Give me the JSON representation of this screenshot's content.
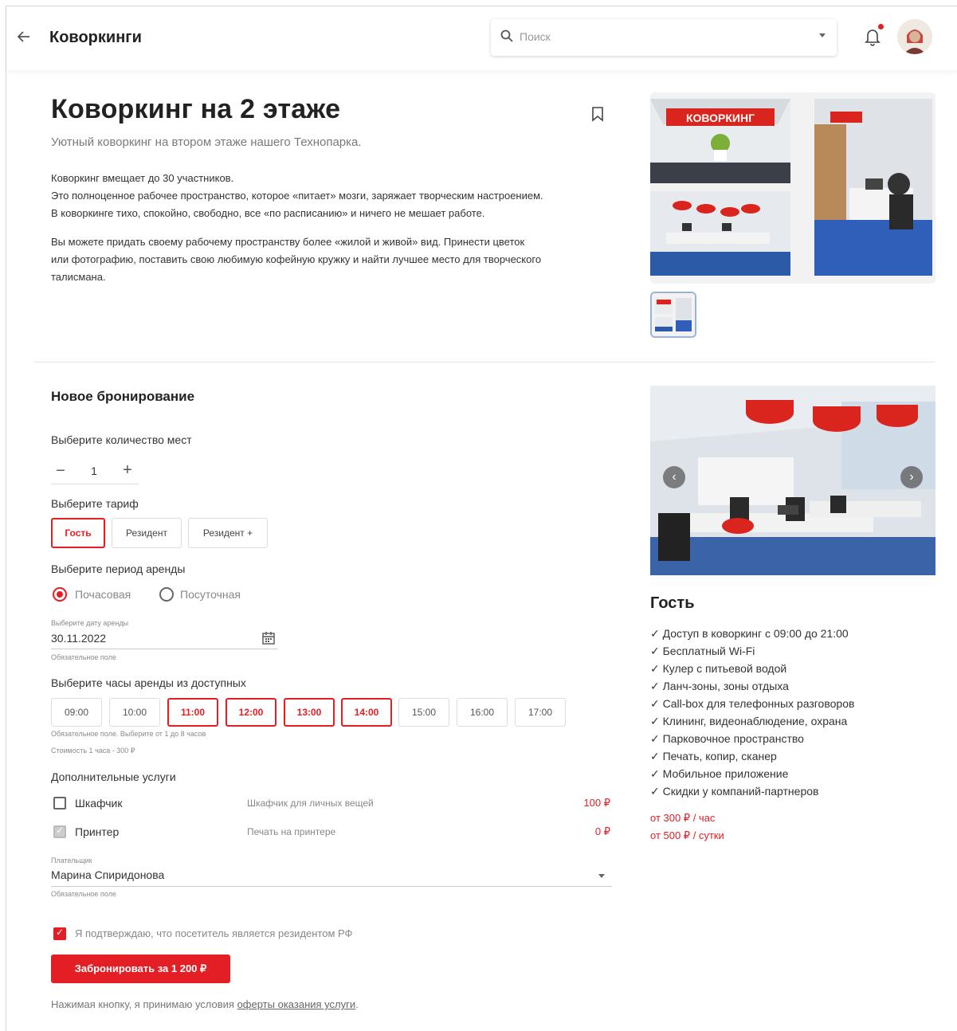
{
  "header": {
    "title": "Коворкинги",
    "search_placeholder": "Поиск"
  },
  "space": {
    "title": "Коворкинг на 2 этаже",
    "subtitle": "Уютный коворкинг на втором этаже нашего Технопарка.",
    "paragraph1_lines": [
      "Коворкинг вмещает до 30 участников.",
      "Это полноценное рабочее пространство, которое «питает» мозги, заряжает творческим настроением.",
      "В коворкинге тихо, спокойно, свободно, все «по расписанию» и ничего не мешает работе."
    ],
    "paragraph2_lines": [
      "Вы можете придать своему рабочему пространству более «жилой и живой» вид. Принести цветок",
      "или фотографию, поставить свою любимую кофейную кружку и найти лучшее место для творческого",
      "талисмана."
    ],
    "gallery_sign": "КОВОРКИНГ"
  },
  "booking": {
    "section_title": "Новое бронирование",
    "seats_label": "Выберите количество мест",
    "seats_value": "1",
    "tariff_label": "Выберите тариф",
    "tariffs": [
      "Гость",
      "Резидент",
      "Резидент +"
    ],
    "period_label": "Выберите период аренды",
    "period_options": [
      "Почасовая",
      "Посуточная"
    ],
    "date_label": "Выберите дату аренды",
    "date_value": "30.11.2022",
    "date_hint": "Обязательное поле",
    "hours_label": "Выберите часы аренды из доступных",
    "slots": [
      "09:00",
      "10:00",
      "11:00",
      "12:00",
      "13:00",
      "14:00",
      "15:00",
      "16:00",
      "17:00"
    ],
    "hours_hint": "Обязательное поле. Выберите от 1 до 8 часов",
    "hours_cost": "Стоимость 1 часа - 300 ₽",
    "extras_label": "Дополнительные услуги",
    "extras": [
      {
        "name": "Шкафчик",
        "desc": "Шкафчик для личных вещей",
        "price": "100 ₽"
      },
      {
        "name": "Принтер",
        "desc": "Печать на принтере",
        "price": "0 ₽"
      }
    ],
    "payer_label": "Плательщик",
    "payer_value": "Марина Спиридонова",
    "payer_hint": "Обязательное поле",
    "confirm_label": "Я подтверждаю, что посетитель является резидентом РФ",
    "submit_label": "Забронировать за 1 200 ₽",
    "terms_text": "Нажимая кнопку, я принимаю условия ",
    "terms_link": "оферты оказания услуги",
    "terms_end": "."
  },
  "tariff_info": {
    "title": "Гость",
    "features": [
      "✓ Доступ в коворкинг с 09:00 до 21:00",
      "✓ Бесплатный Wi-Fi",
      "✓ Кулер с питьевой водой",
      "✓ Ланч-зоны, зоны отдыха",
      "✓ Call-box для телефонных разговоров",
      "✓ Клининг, видеонаблюдение, охрана",
      "✓ Парковочное пространство",
      "✓ Печать, копир, сканер",
      "✓ Мобильное приложение",
      "✓ Скидки у компаний-партнеров"
    ],
    "price_hour": "от 300 ₽ / час",
    "price_day": "от 500 ₽ / сутки"
  },
  "colors": {
    "accent": "#e31e24",
    "text": "#222222",
    "muted": "#888888"
  }
}
